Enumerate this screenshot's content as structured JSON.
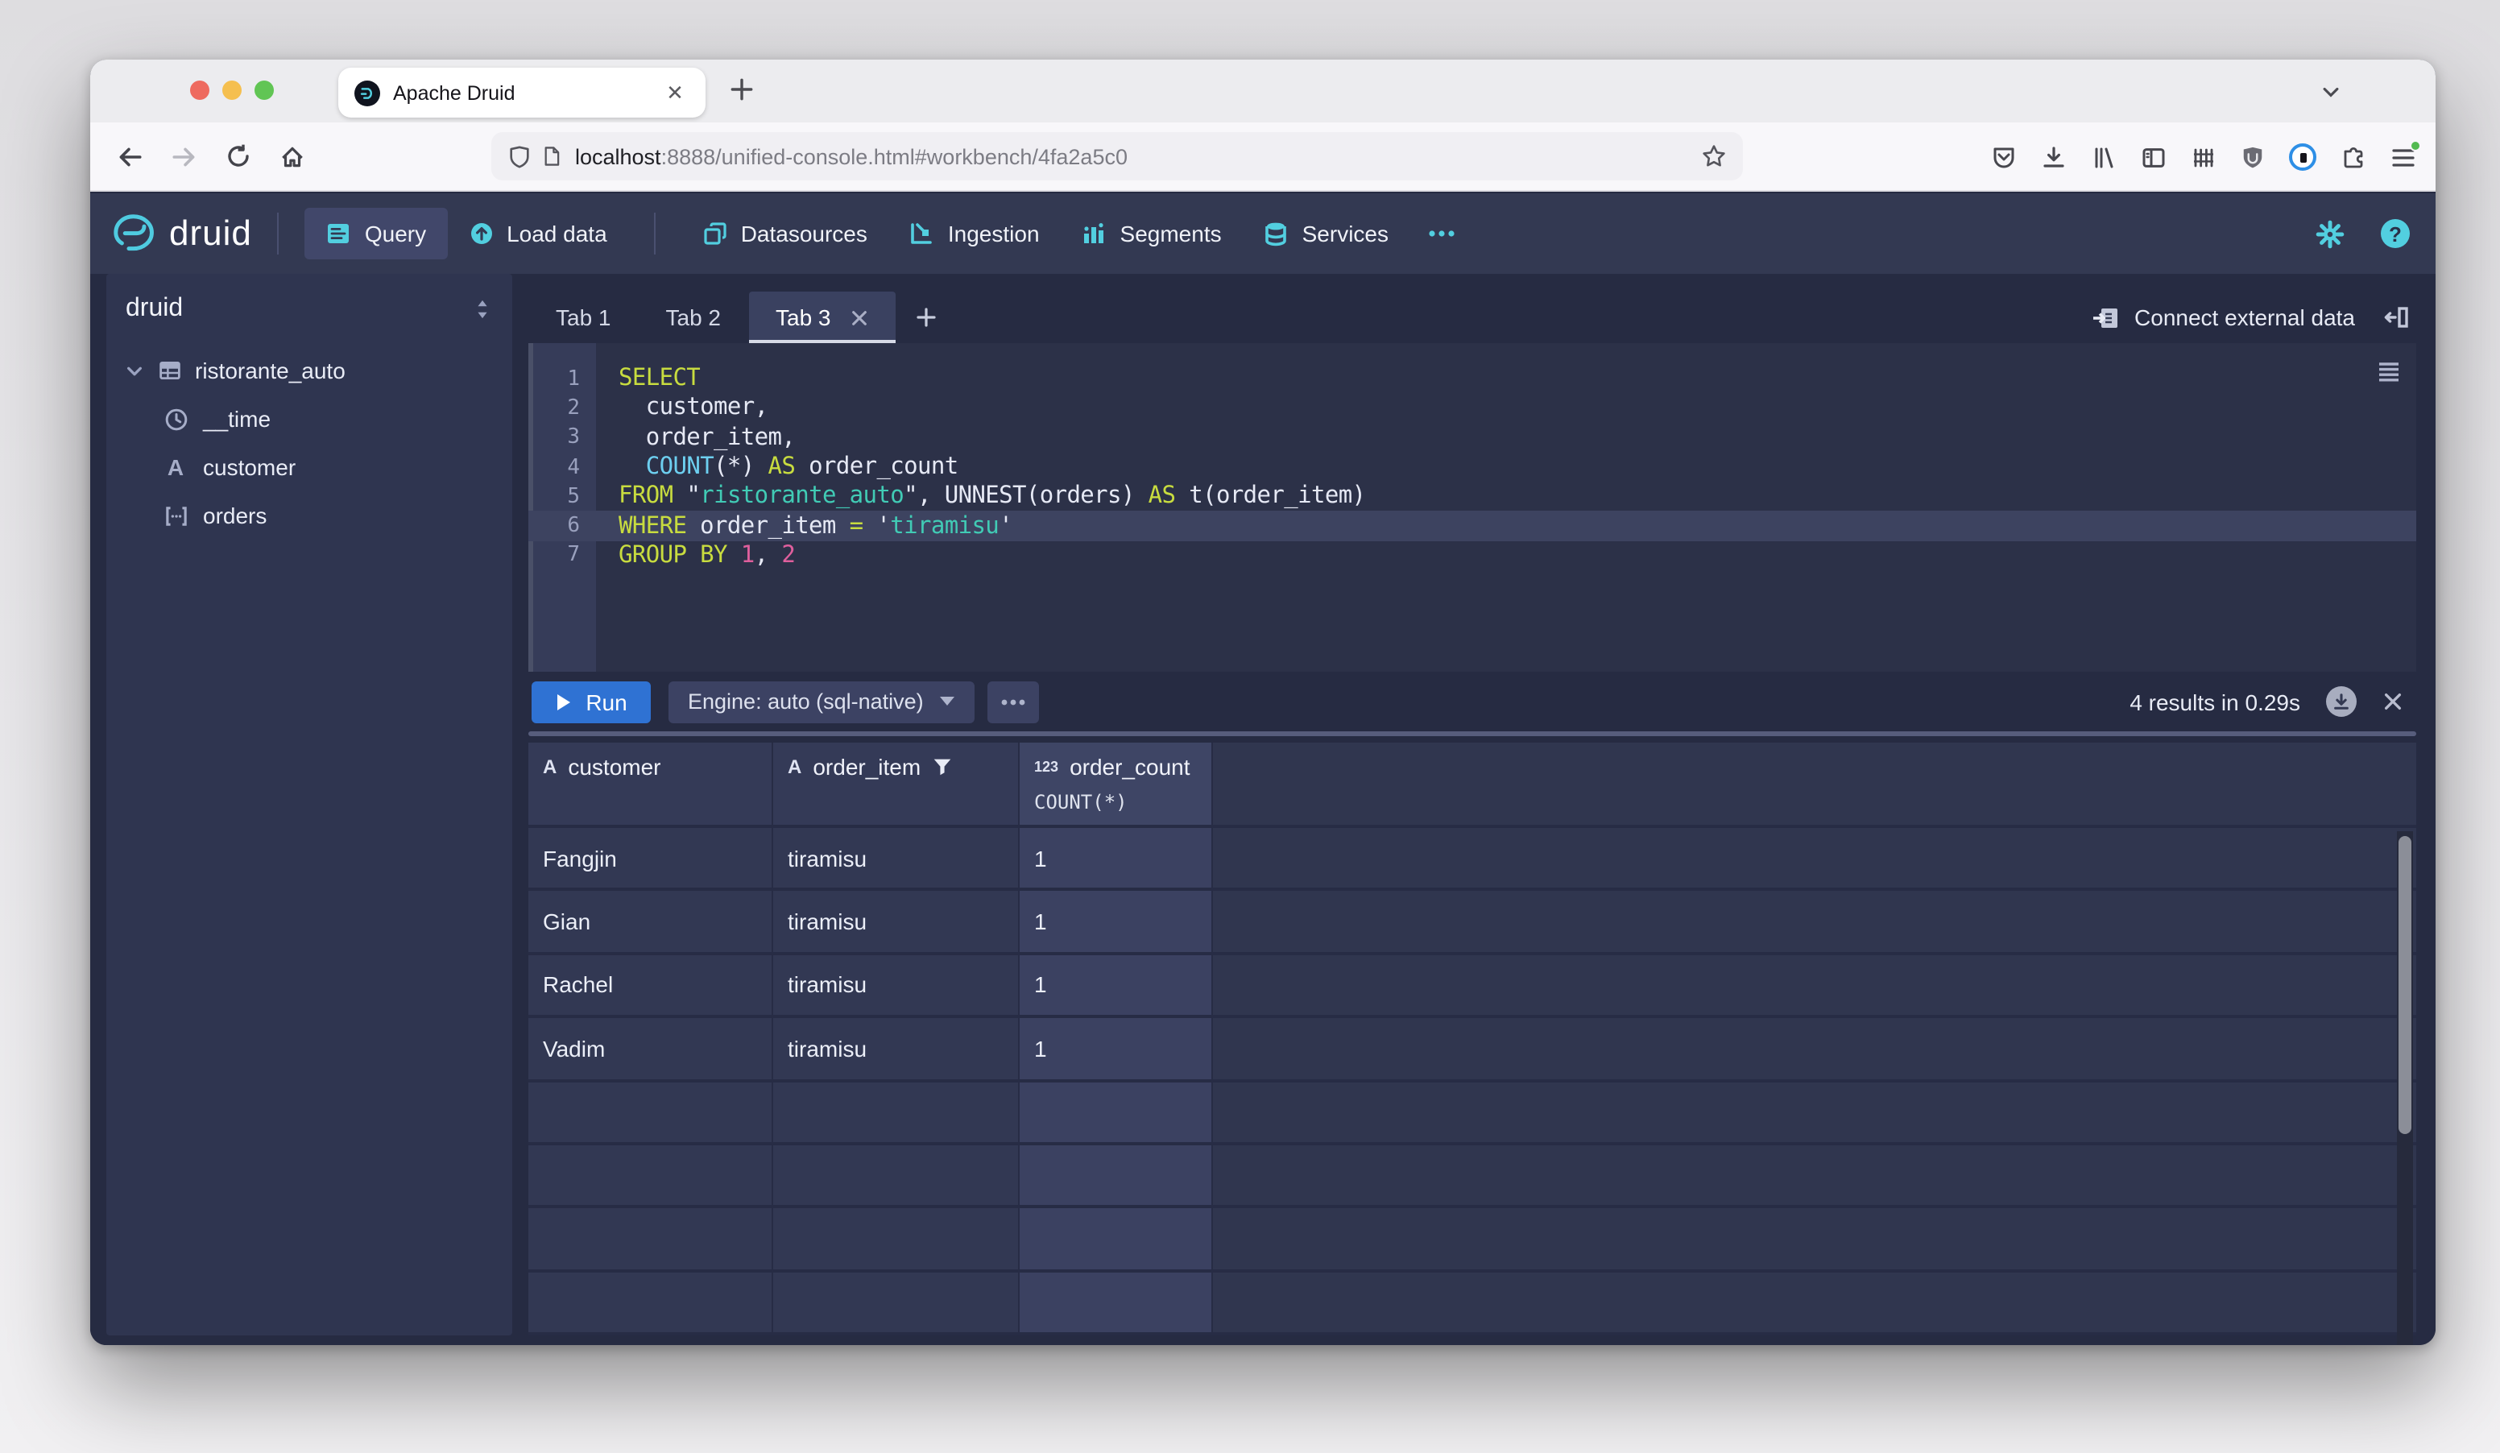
{
  "browser": {
    "tab_title": "Apache Druid",
    "url": {
      "host": "localhost",
      "rest": ":8888/unified-console.html#workbench/4fa2a5c0"
    }
  },
  "nav": {
    "brand": "druid",
    "items": [
      {
        "label": "Query",
        "active": true
      },
      {
        "label": "Load data",
        "active": false
      },
      {
        "label": "Datasources",
        "active": false
      },
      {
        "label": "Ingestion",
        "active": false
      },
      {
        "label": "Segments",
        "active": false
      },
      {
        "label": "Services",
        "active": false
      }
    ]
  },
  "sidebar": {
    "schema": "druid",
    "tree": [
      {
        "label": "ristorante_auto",
        "type": "datasource"
      },
      {
        "label": "__time",
        "type": "time"
      },
      {
        "label": "customer",
        "type": "string"
      },
      {
        "label": "orders",
        "type": "array"
      }
    ]
  },
  "workbench": {
    "tabs": [
      {
        "label": "Tab 1",
        "active": false
      },
      {
        "label": "Tab 2",
        "active": false
      },
      {
        "label": "Tab 3",
        "active": true
      }
    ],
    "connect_external_label": "Connect external data",
    "editor": {
      "line_numbers": [
        "1",
        "2",
        "3",
        "4",
        "5",
        "6",
        "7"
      ],
      "l1": [
        [
          "kw",
          "SELECT"
        ]
      ],
      "l2": [
        [
          "pl",
          "  customer,"
        ]
      ],
      "l3": [
        [
          "pl",
          "  order_item,"
        ]
      ],
      "l4": [
        [
          "pl",
          "  "
        ],
        [
          "fn",
          "COUNT"
        ],
        [
          "pl",
          "(*) "
        ],
        [
          "kw",
          "AS"
        ],
        [
          "pl",
          " order_count"
        ]
      ],
      "l5": [
        [
          "kw",
          "FROM"
        ],
        [
          "pl",
          " \""
        ],
        [
          "str",
          "ristorante_auto"
        ],
        [
          "pl",
          "\", UNNEST(orders) "
        ],
        [
          "kw",
          "AS"
        ],
        [
          "pl",
          " t(order_item)"
        ]
      ],
      "l6": [
        [
          "kw",
          "WHERE"
        ],
        [
          "pl",
          " order_item "
        ],
        [
          "kw",
          "="
        ],
        [
          "pl",
          " '"
        ],
        [
          "str",
          "tiramisu"
        ],
        [
          "pl",
          "'"
        ]
      ],
      "l7": [
        [
          "kw",
          "GROUP BY"
        ],
        [
          "pl",
          " "
        ],
        [
          "num",
          "1"
        ],
        [
          "pl",
          ", "
        ],
        [
          "num",
          "2"
        ]
      ]
    },
    "run_label": "Run",
    "engine_label": "Engine: auto (sql-native)",
    "results_summary": "4 results in 0.29s",
    "table": {
      "columns": [
        {
          "glyph": "A",
          "name": "customer",
          "filtered": false
        },
        {
          "glyph": "A",
          "name": "order_item",
          "filtered": true
        },
        {
          "glyph": "123",
          "name": "order_count",
          "sub": "COUNT(*)"
        }
      ],
      "rows": [
        [
          "Fangjin",
          "tiramisu",
          "1"
        ],
        [
          "Gian",
          "tiramisu",
          "1"
        ],
        [
          "Rachel",
          "tiramisu",
          "1"
        ],
        [
          "Vadim",
          "tiramisu",
          "1"
        ]
      ]
    }
  },
  "colors": {
    "accent_cyan": "#52cfe0",
    "run_blue": "#2f72d3",
    "syntax_keyword": "#c8dc3f",
    "syntax_function": "#6dcff0",
    "syntax_string": "#41cbb5",
    "syntax_number": "#df5f9d",
    "panel_bg": "#2f3550",
    "nav_bg": "#333952"
  }
}
